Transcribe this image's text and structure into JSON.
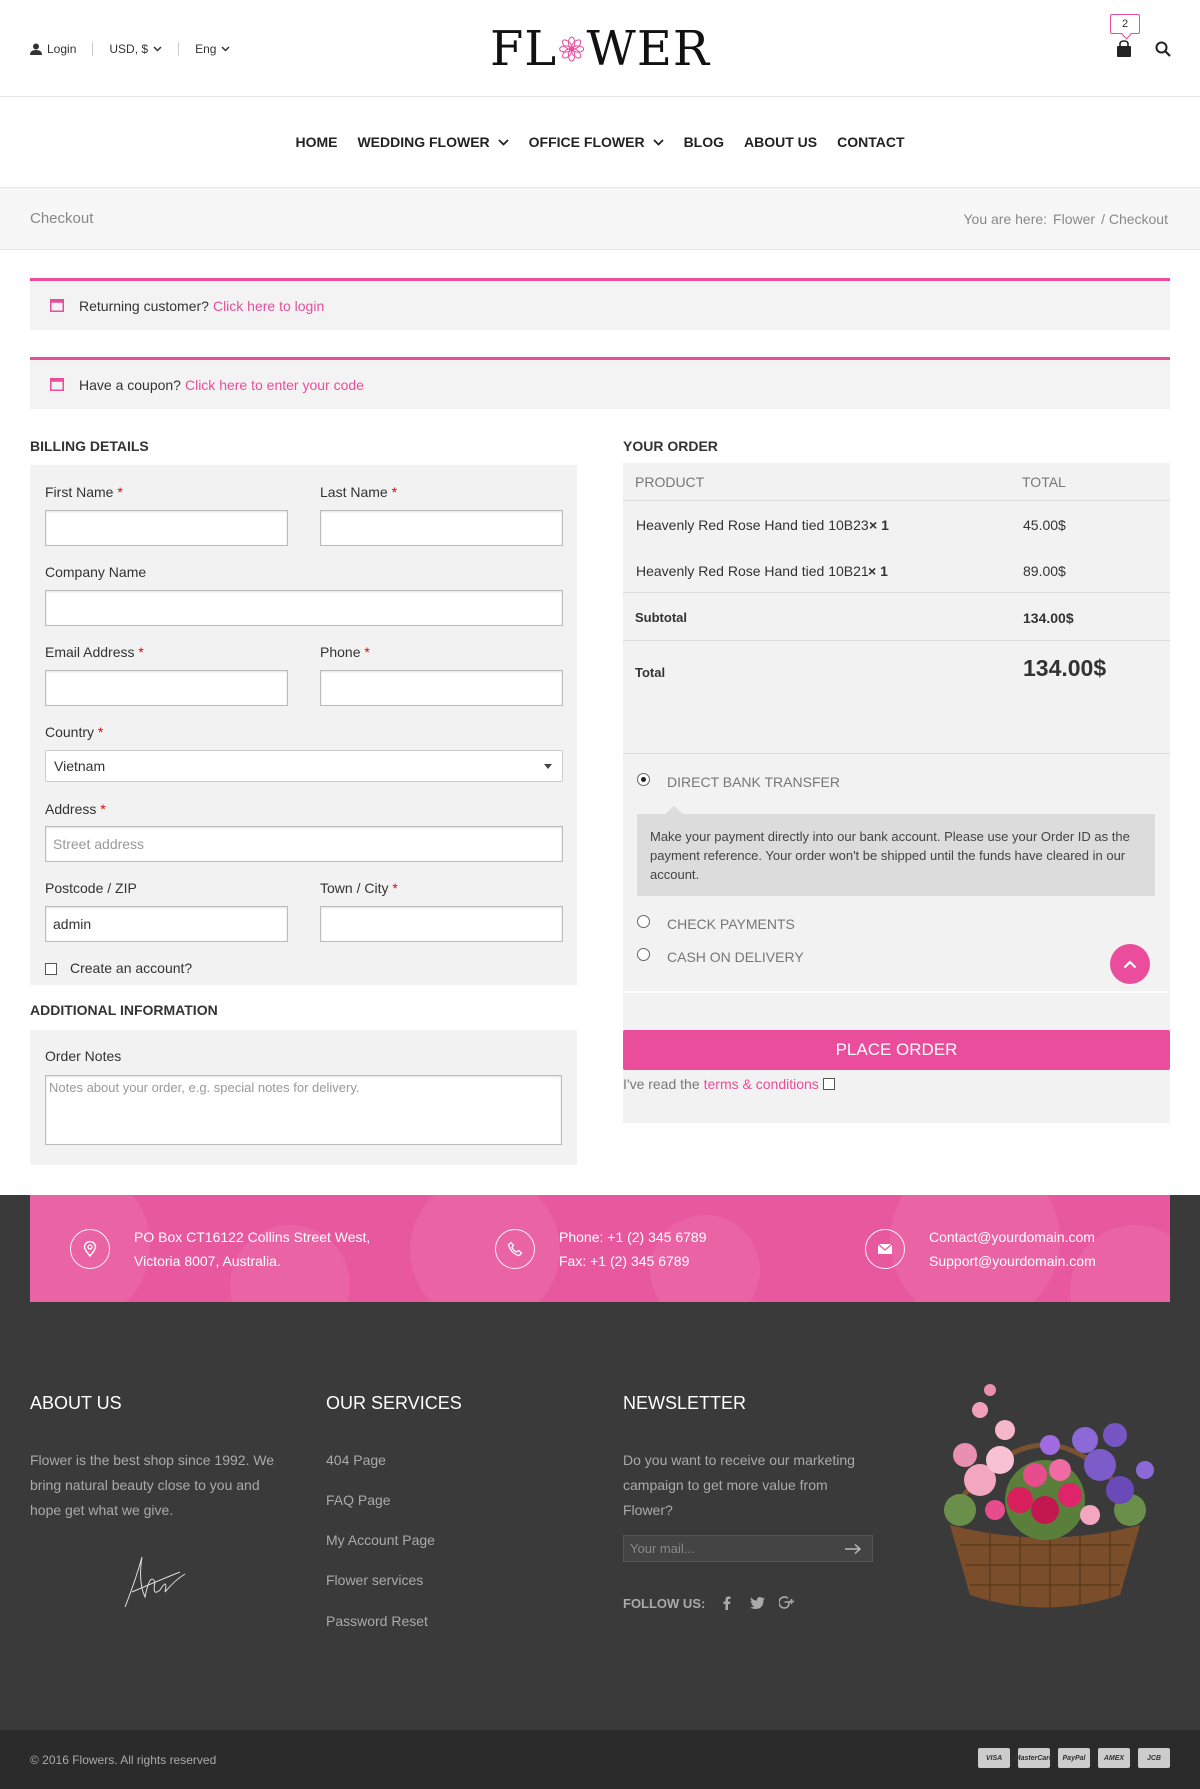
{
  "topbar": {
    "login": "Login",
    "currency": "USD, $",
    "language": "Eng",
    "logo_left": "FL",
    "logo_right": "WER",
    "cart_count": "2"
  },
  "nav": {
    "items": [
      "HOME",
      "WEDDING FLOWER",
      "OFFICE FLOWER",
      "BLOG",
      "ABOUT US",
      "CONTACT"
    ]
  },
  "breadcrumb": {
    "title": "Checkout",
    "prefix": "You are here:",
    "home": "Flower",
    "current": "/ Checkout"
  },
  "notices": {
    "returning_text": "Returning customer?",
    "returning_link": "Click here to login",
    "coupon_text": "Have a coupon?",
    "coupon_link": "Click here to enter your code"
  },
  "billing": {
    "title": "BILLING DETAILS",
    "first_name_label": "First Name",
    "last_name_label": "Last Name",
    "company_label": "Company Name",
    "email_label": "Email Address",
    "phone_label": "Phone",
    "country_label": "Country",
    "country_value": "Vietnam",
    "address_label": "Address",
    "address_placeholder": "Street address",
    "postcode_label": "Postcode / ZIP",
    "postcode_value": "admin",
    "town_label": "Town / City",
    "create_account": "Create an account?",
    "required_mark": "*"
  },
  "additional": {
    "title": "ADDITIONAL INFORMATION",
    "notes_label": "Order Notes",
    "notes_placeholder": "Notes about your order, e.g. special notes for delivery."
  },
  "order": {
    "title": "YOUR ORDER",
    "col_product": "PRODUCT",
    "col_total": "TOTAL",
    "items": [
      {
        "name": "Heavenly Red Rose Hand tied 10B23",
        "qty": "× 1",
        "total": "45.00$"
      },
      {
        "name": "Heavenly Red Rose Hand tied 10B21",
        "qty": "× 1",
        "total": "89.00$"
      }
    ],
    "subtotal_label": "Subtotal",
    "subtotal_value": "134.00$",
    "total_label": "Total",
    "total_value": "134.00$",
    "payments": [
      {
        "label": "DIRECT BANK TRANSFER",
        "selected": true
      },
      {
        "label": "CHECK PAYMENTS",
        "selected": false
      },
      {
        "label": "CASH ON DELIVERY",
        "selected": false
      }
    ],
    "bank_description": "Make your payment directly into our bank account. Please use your Order ID as the payment reference. Your order won't be shipped until the funds have cleared in our account.",
    "place_order": "PLACE ORDER",
    "terms_text": "I've read the",
    "terms_link": "terms & conditions"
  },
  "contact": {
    "address_line1": "PO Box CT16122 Collins Street West,",
    "address_line2": "Victoria 8007, Australia.",
    "phone_line1": "Phone: +1 (2) 345 6789",
    "phone_line2": "Fax: +1 (2) 345 6789",
    "email_line1": "Contact@yourdomain.com",
    "email_line2": "Support@yourdomain.com"
  },
  "footer": {
    "about_title": "ABOUT US",
    "about_text": "Flower is the best shop since 1992. We bring natural beauty close to you and hope get what we give.",
    "services_title": "OUR SERVICES",
    "services": [
      "404 Page",
      "FAQ Page",
      "My Account Page",
      "Flower services",
      "Password Reset"
    ],
    "newsletter_title": "NEWSLETTER",
    "newsletter_text": "Do you want to receive our marketing campaign to get more value from Flower?",
    "mail_placeholder": "Your mail...",
    "follow_label": "FOLLOW US:",
    "copyright": "© 2016 Flowers. All rights reserved",
    "cards": [
      "VISA",
      "MasterCard",
      "PayPal",
      "AMEX",
      "JCB"
    ]
  },
  "colors": {
    "accent": "#e94d9b",
    "footer_bg": "#3a3a3a",
    "bottom_bg": "#2b2b2b"
  }
}
